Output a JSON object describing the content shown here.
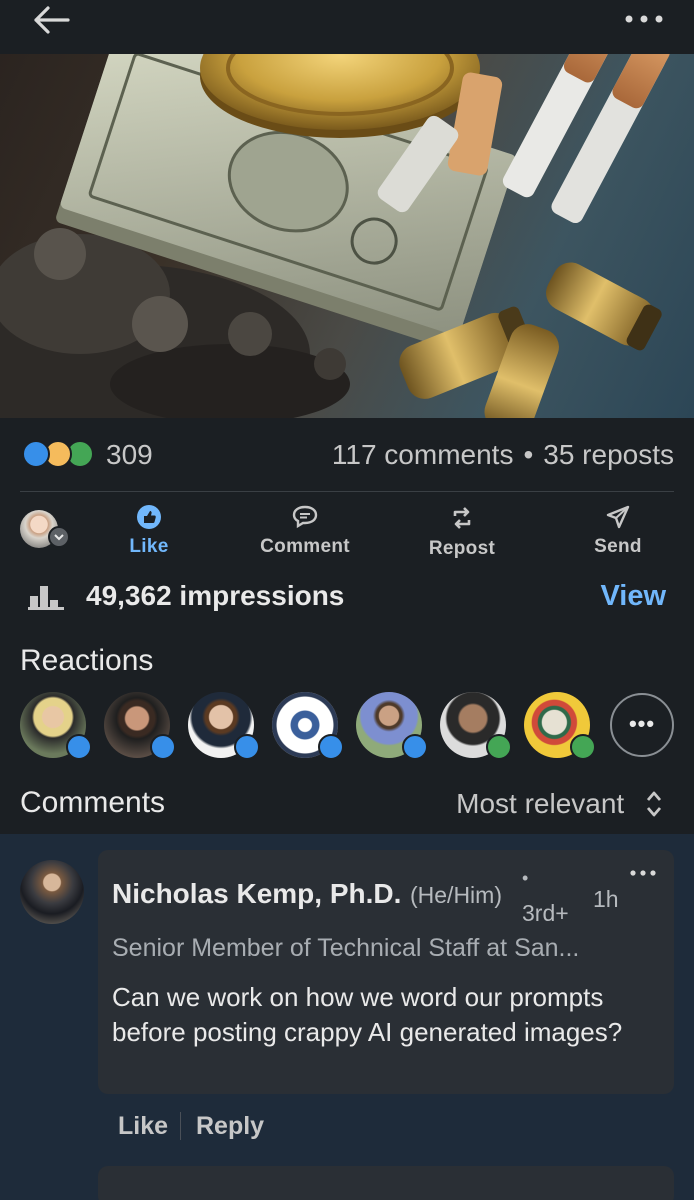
{
  "header": {
    "back_icon": "arrow-left-icon",
    "more_icon": "ellipsis-horizontal-icon"
  },
  "post_image": {
    "colors": {
      "gold": "#c9a13e",
      "brass": "#c8a24a",
      "bill": "#c8cdb7",
      "ash": "#3a3835"
    }
  },
  "social": {
    "reaction_icons": [
      {
        "name": "like-reaction-icon",
        "color": "#378fe9"
      },
      {
        "name": "insightful-reaction-icon",
        "color": "#f5bb5c"
      },
      {
        "name": "support-reaction-icon",
        "color": "#44a655"
      }
    ],
    "reaction_count": "309",
    "comments": "117 comments",
    "separator": "•",
    "reposts": "35 reposts"
  },
  "actions": {
    "like": "Like",
    "comment": "Comment",
    "repost": "Repost",
    "send": "Send"
  },
  "impressions": {
    "text": "49,362 impressions",
    "view": "View"
  },
  "reactions": {
    "heading": "Reactions",
    "more": "•••",
    "people": [
      {
        "badge": "like",
        "skin": "#d8b39a",
        "bg": "#6b7a5c"
      },
      {
        "badge": "like",
        "skin": "#c9977a",
        "bg": "#5a4d45"
      },
      {
        "badge": "like",
        "skin": "#e3c2a8",
        "bg": "#f2f2f2"
      },
      {
        "badge": "like",
        "skin": "#3a5f9b",
        "bg": "#ffffff"
      },
      {
        "badge": "like",
        "skin": "#caa184",
        "bg": "#8faa7a"
      },
      {
        "badge": "support",
        "skin": "#a57d61",
        "bg": "#dcdcdc"
      },
      {
        "badge": "support",
        "skin": "#e6e1d3",
        "bg": "#f0c93a"
      }
    ],
    "colors": {
      "like": "#378fe9",
      "support": "#44a655"
    }
  },
  "comments": {
    "heading": "Comments",
    "sort_label": "Most relevant",
    "items": [
      {
        "author": "Nicholas Kemp, Ph.D.",
        "pronouns": "(He/Him)",
        "degree_dot": "•",
        "degree": "3rd+",
        "time": "1h",
        "title": "Senior Member of Technical Staff at San...",
        "text": "Can we work on how we word our prompts before posting crappy AI generated images?",
        "like": "Like",
        "reply": "Reply"
      }
    ]
  },
  "colors": {
    "background": "#1b1f23",
    "accent": "#71b7fb",
    "comments_bg": "#1e2b3a"
  }
}
